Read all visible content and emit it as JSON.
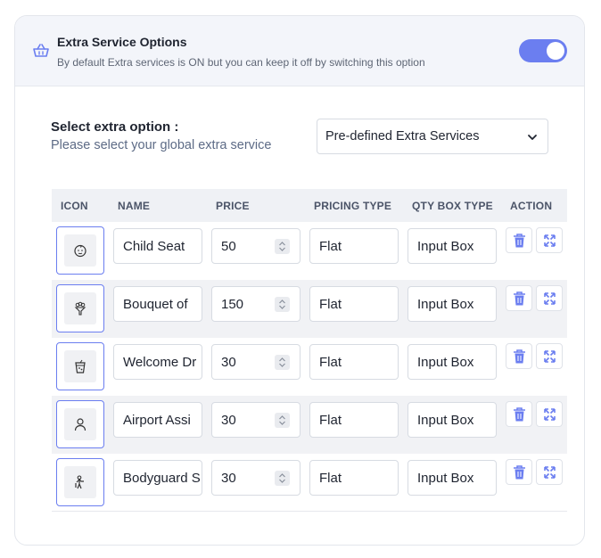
{
  "header": {
    "title": "Extra Service Options",
    "description": "By default Extra services is ON but you can keep it off by switching this option",
    "toggle_on": true
  },
  "selector": {
    "label": "Select extra option :",
    "sublabel": "Please select your global extra service",
    "value": "Pre-defined Extra Services"
  },
  "table": {
    "headers": {
      "icon": "ICON",
      "name": "NAME",
      "price": "PRICE",
      "pricing_type": "PRICING TYPE",
      "qty_box_type": "QTY BOX TYPE",
      "action": "ACTION"
    },
    "rows": [
      {
        "icon": "baby-face-icon",
        "name": "Child Seat",
        "price": "50",
        "pricing_type": "Flat",
        "qty_box_type": "Input Box"
      },
      {
        "icon": "bouquet-icon",
        "name": "Bouquet of",
        "price": "150",
        "pricing_type": "Flat",
        "qty_box_type": "Input Box"
      },
      {
        "icon": "drink-cup-icon",
        "name": "Welcome Dr",
        "price": "30",
        "pricing_type": "Flat",
        "qty_box_type": "Input Box"
      },
      {
        "icon": "person-icon",
        "name": "Airport Assi",
        "price": "30",
        "pricing_type": "Flat",
        "qty_box_type": "Input Box"
      },
      {
        "icon": "bodyguard-icon",
        "name": "Bodyguard S",
        "price": "30",
        "pricing_type": "Flat",
        "qty_box_type": "Input Box"
      }
    ]
  },
  "colors": {
    "accent": "#6b7ef0",
    "header_bg": "#f3f5fa",
    "row_alt_bg": "#f1f2f5"
  }
}
